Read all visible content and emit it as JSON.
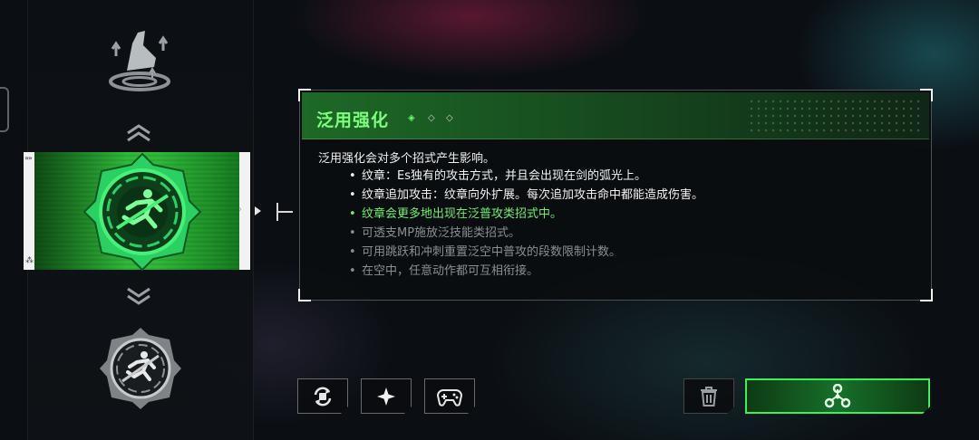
{
  "skill_list": {
    "top_icon": "boot-dash-icon",
    "scroll_up_icon": "double-chevron-up-icon",
    "scroll_down_icon": "double-chevron-down-icon",
    "selected_icon": "running-figure-emblem-icon",
    "other_icon": "running-figure-emblem-icon",
    "card_tag_top": "»»",
    "card_tag_bottom": "⁂",
    "card_arrow": "›"
  },
  "skill_panel": {
    "title": "泛用强化",
    "tiers": [
      "◈",
      "◇",
      "◇"
    ],
    "intro": "泛用强化会对多个招式产生影响。",
    "effects": [
      {
        "text": "纹章：Es独有的攻击方式，并且会出现在剑的弧光上。",
        "state": "active"
      },
      {
        "text": "纹章追加攻击：纹章向外扩展。每次追加攻击命中都能造成伤害。",
        "state": "active"
      },
      {
        "text": "纹章会更多地出现在泛普攻类招式中。",
        "state": "highlight"
      },
      {
        "text": "可透支MP施放泛技能类招式。",
        "state": "locked"
      },
      {
        "text": "可用跳跃和冲刺重置泛空中普攻的段数限制计数。",
        "state": "locked"
      },
      {
        "text": "在空中，任意动作都可互相衔接。",
        "state": "locked"
      }
    ]
  },
  "actions": {
    "swap_icon": "swap-cycle-icon",
    "star_icon": "sparkle-star-icon",
    "gamepad_icon": "gamepad-icon",
    "trash_icon": "trash-icon",
    "equip_icon": "skill-nodes-icon"
  },
  "colors": {
    "accent_green": "#3df05a",
    "title_green": "#7dff7d",
    "highlight_text": "#6ef06e",
    "locked_text": "#8a8f92"
  }
}
